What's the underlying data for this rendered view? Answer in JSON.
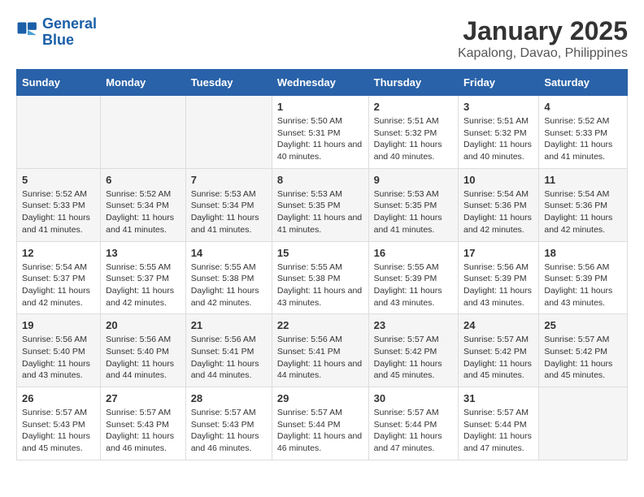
{
  "logo": {
    "text_general": "General",
    "text_blue": "Blue"
  },
  "title": "January 2025",
  "subtitle": "Kapalong, Davao, Philippines",
  "header_row": [
    "Sunday",
    "Monday",
    "Tuesday",
    "Wednesday",
    "Thursday",
    "Friday",
    "Saturday"
  ],
  "weeks": [
    [
      {
        "day": "",
        "info": ""
      },
      {
        "day": "",
        "info": ""
      },
      {
        "day": "",
        "info": ""
      },
      {
        "day": "1",
        "info": "Sunrise: 5:50 AM\nSunset: 5:31 PM\nDaylight: 11 hours and 40 minutes."
      },
      {
        "day": "2",
        "info": "Sunrise: 5:51 AM\nSunset: 5:32 PM\nDaylight: 11 hours and 40 minutes."
      },
      {
        "day": "3",
        "info": "Sunrise: 5:51 AM\nSunset: 5:32 PM\nDaylight: 11 hours and 40 minutes."
      },
      {
        "day": "4",
        "info": "Sunrise: 5:52 AM\nSunset: 5:33 PM\nDaylight: 11 hours and 41 minutes."
      }
    ],
    [
      {
        "day": "5",
        "info": "Sunrise: 5:52 AM\nSunset: 5:33 PM\nDaylight: 11 hours and 41 minutes."
      },
      {
        "day": "6",
        "info": "Sunrise: 5:52 AM\nSunset: 5:34 PM\nDaylight: 11 hours and 41 minutes."
      },
      {
        "day": "7",
        "info": "Sunrise: 5:53 AM\nSunset: 5:34 PM\nDaylight: 11 hours and 41 minutes."
      },
      {
        "day": "8",
        "info": "Sunrise: 5:53 AM\nSunset: 5:35 PM\nDaylight: 11 hours and 41 minutes."
      },
      {
        "day": "9",
        "info": "Sunrise: 5:53 AM\nSunset: 5:35 PM\nDaylight: 11 hours and 41 minutes."
      },
      {
        "day": "10",
        "info": "Sunrise: 5:54 AM\nSunset: 5:36 PM\nDaylight: 11 hours and 42 minutes."
      },
      {
        "day": "11",
        "info": "Sunrise: 5:54 AM\nSunset: 5:36 PM\nDaylight: 11 hours and 42 minutes."
      }
    ],
    [
      {
        "day": "12",
        "info": "Sunrise: 5:54 AM\nSunset: 5:37 PM\nDaylight: 11 hours and 42 minutes."
      },
      {
        "day": "13",
        "info": "Sunrise: 5:55 AM\nSunset: 5:37 PM\nDaylight: 11 hours and 42 minutes."
      },
      {
        "day": "14",
        "info": "Sunrise: 5:55 AM\nSunset: 5:38 PM\nDaylight: 11 hours and 42 minutes."
      },
      {
        "day": "15",
        "info": "Sunrise: 5:55 AM\nSunset: 5:38 PM\nDaylight: 11 hours and 43 minutes."
      },
      {
        "day": "16",
        "info": "Sunrise: 5:55 AM\nSunset: 5:39 PM\nDaylight: 11 hours and 43 minutes."
      },
      {
        "day": "17",
        "info": "Sunrise: 5:56 AM\nSunset: 5:39 PM\nDaylight: 11 hours and 43 minutes."
      },
      {
        "day": "18",
        "info": "Sunrise: 5:56 AM\nSunset: 5:39 PM\nDaylight: 11 hours and 43 minutes."
      }
    ],
    [
      {
        "day": "19",
        "info": "Sunrise: 5:56 AM\nSunset: 5:40 PM\nDaylight: 11 hours and 43 minutes."
      },
      {
        "day": "20",
        "info": "Sunrise: 5:56 AM\nSunset: 5:40 PM\nDaylight: 11 hours and 44 minutes."
      },
      {
        "day": "21",
        "info": "Sunrise: 5:56 AM\nSunset: 5:41 PM\nDaylight: 11 hours and 44 minutes."
      },
      {
        "day": "22",
        "info": "Sunrise: 5:56 AM\nSunset: 5:41 PM\nDaylight: 11 hours and 44 minutes."
      },
      {
        "day": "23",
        "info": "Sunrise: 5:57 AM\nSunset: 5:42 PM\nDaylight: 11 hours and 45 minutes."
      },
      {
        "day": "24",
        "info": "Sunrise: 5:57 AM\nSunset: 5:42 PM\nDaylight: 11 hours and 45 minutes."
      },
      {
        "day": "25",
        "info": "Sunrise: 5:57 AM\nSunset: 5:42 PM\nDaylight: 11 hours and 45 minutes."
      }
    ],
    [
      {
        "day": "26",
        "info": "Sunrise: 5:57 AM\nSunset: 5:43 PM\nDaylight: 11 hours and 45 minutes."
      },
      {
        "day": "27",
        "info": "Sunrise: 5:57 AM\nSunset: 5:43 PM\nDaylight: 11 hours and 46 minutes."
      },
      {
        "day": "28",
        "info": "Sunrise: 5:57 AM\nSunset: 5:43 PM\nDaylight: 11 hours and 46 minutes."
      },
      {
        "day": "29",
        "info": "Sunrise: 5:57 AM\nSunset: 5:44 PM\nDaylight: 11 hours and 46 minutes."
      },
      {
        "day": "30",
        "info": "Sunrise: 5:57 AM\nSunset: 5:44 PM\nDaylight: 11 hours and 47 minutes."
      },
      {
        "day": "31",
        "info": "Sunrise: 5:57 AM\nSunset: 5:44 PM\nDaylight: 11 hours and 47 minutes."
      },
      {
        "day": "",
        "info": ""
      }
    ]
  ]
}
